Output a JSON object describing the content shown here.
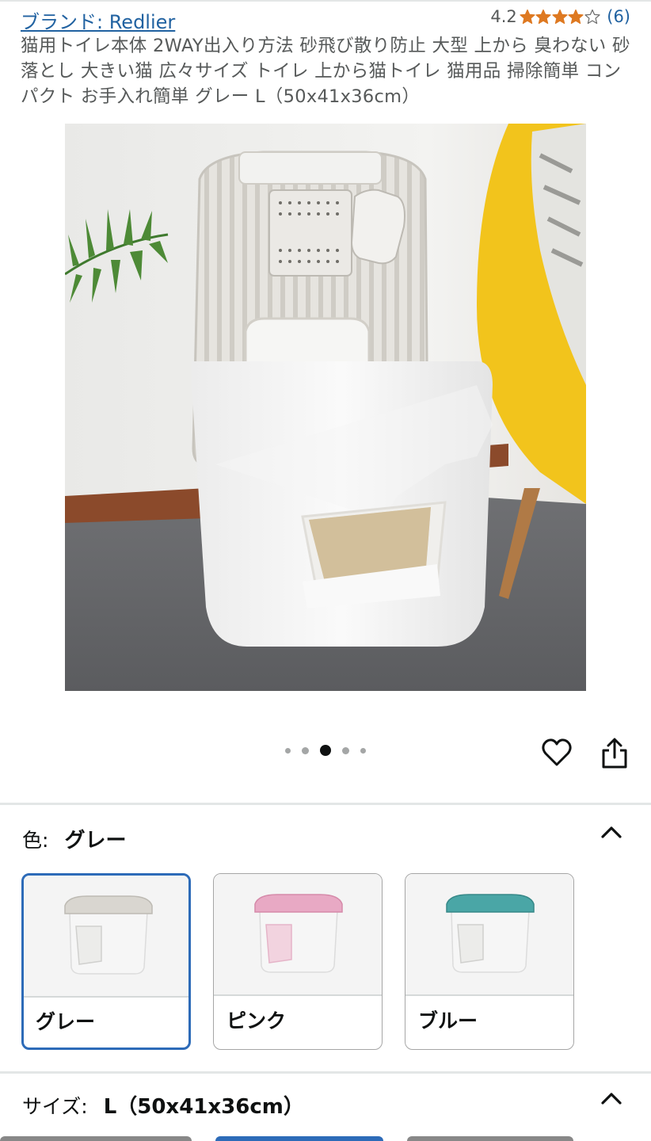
{
  "header": {
    "brand": "ブランド: Redlier",
    "rating": "4.2",
    "stars_filled": 4,
    "stars_total": 5,
    "review_count": "(6)"
  },
  "product": {
    "title": "猫用トイレ本体 2WAY出入り方法 砂飛び散り防止 大型 上から 臭わない 砂落とし 大きい猫 広々サイズ トイレ 上から猫トイレ 猫用品 掃除簡単 コンパクト お手入れ簡単 グレー L（50x41x36cm）"
  },
  "gallery": {
    "image_count": 5,
    "active_index": 2
  },
  "color_section": {
    "label": "色:",
    "value": "グレー",
    "options": [
      {
        "label": "グレー",
        "lid_color": "#d9d6d0",
        "selected": true
      },
      {
        "label": "ピンク",
        "lid_color": "#e8a9c4",
        "selected": false
      },
      {
        "label": "ブルー",
        "lid_color": "#4aa6a6",
        "selected": false
      }
    ]
  },
  "size_section": {
    "label": "サイズ:",
    "value": "L（50x41x36cm）"
  },
  "colors": {
    "link": "#2162a1",
    "star": "#de7921",
    "selected_border": "#2d6bb8"
  },
  "icons": [
    "star-icon",
    "heart-icon",
    "share-icon",
    "chevron-up-icon"
  ]
}
